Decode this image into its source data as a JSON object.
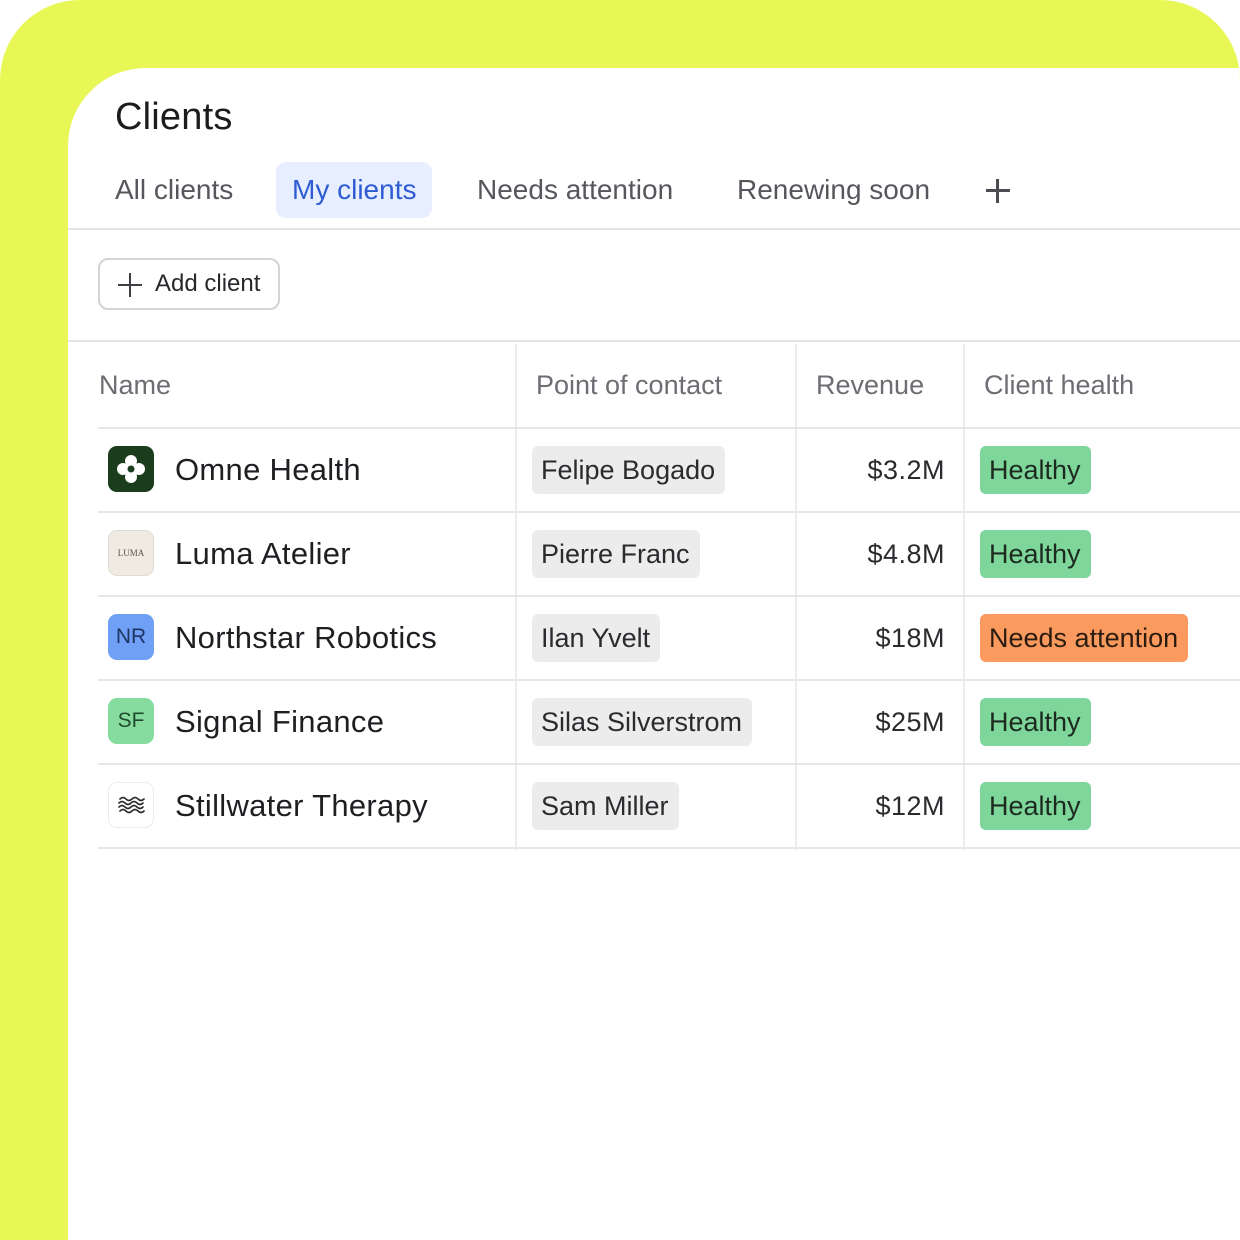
{
  "header": {
    "title": "Clients"
  },
  "tabs": [
    {
      "label": "All clients",
      "active": false
    },
    {
      "label": "My clients",
      "active": true
    },
    {
      "label": "Needs attention",
      "active": false
    },
    {
      "label": "Renewing soon",
      "active": false
    }
  ],
  "toolbar": {
    "add_client_label": "Add client",
    "add_tab_icon": "plus-icon"
  },
  "table": {
    "columns": [
      "Name",
      "Point of contact",
      "Revenue",
      "Client health"
    ],
    "rows": [
      {
        "name": "Omne Health",
        "logo": "flower-icon",
        "contact": "Felipe Bogado",
        "revenue": "$3.2M",
        "health": "Healthy"
      },
      {
        "name": "Luma Atelier",
        "logo": "luma-logo",
        "logo_text": "LUMA",
        "contact": "Pierre Franc",
        "revenue": "$4.8M",
        "health": "Healthy"
      },
      {
        "name": "Northstar Robotics",
        "logo": "initials-avatar",
        "logo_text": "NR",
        "contact": "Ilan Yvelt",
        "revenue": "$18M",
        "health": "Needs attention"
      },
      {
        "name": "Signal Finance",
        "logo": "initials-avatar",
        "logo_text": "SF",
        "contact": "Silas Silverstrom",
        "revenue": "$25M",
        "health": "Healthy"
      },
      {
        "name": "Stillwater Therapy",
        "logo": "waves-icon",
        "contact": "Sam Miller",
        "revenue": "$12M",
        "health": "Healthy"
      }
    ]
  },
  "colors": {
    "background_accent": "#e8f755",
    "active_tab_bg": "#e6eeff",
    "active_tab_text": "#2f5bd3",
    "healthy": "#7ed69a",
    "needs_attention": "#fb9a5e",
    "avatar_nr": "#6fa0f5",
    "avatar_sf": "#86dc9e",
    "contact_chip": "#ececec"
  }
}
